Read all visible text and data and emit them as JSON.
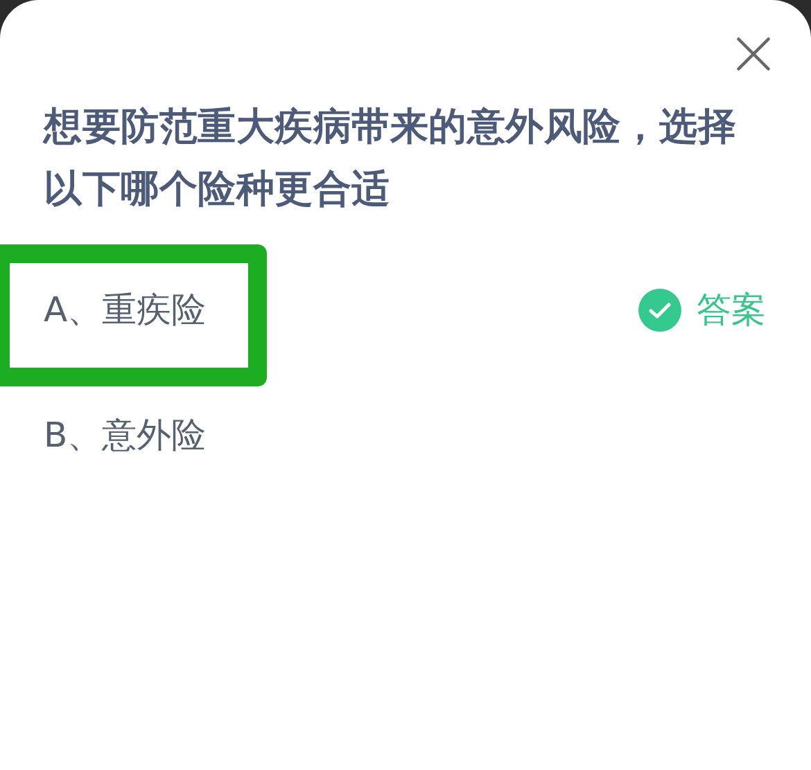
{
  "question": "想要防范重大疾病带来的意外风险，选择以下哪个险种更合适",
  "options": [
    {
      "label": "A、重疾险",
      "highlighted": true,
      "answer_tag": "答案"
    },
    {
      "label": "B、意外险",
      "highlighted": false
    }
  ]
}
